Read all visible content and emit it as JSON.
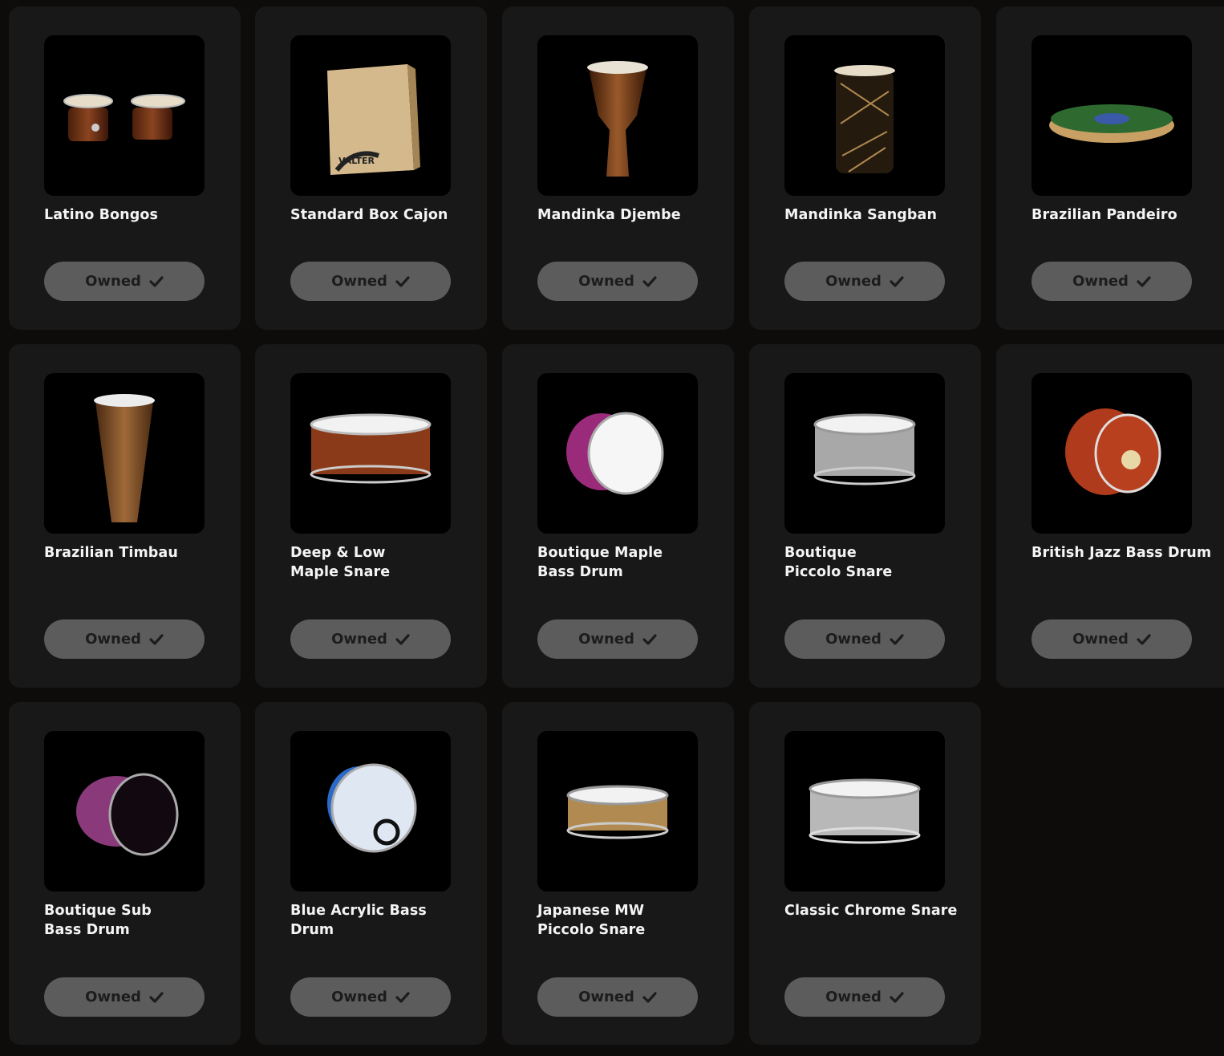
{
  "products": [
    {
      "name": "Latino Bongos",
      "status": "Owned",
      "icon": "bongos-icon"
    },
    {
      "name": "Standard Box Cajon",
      "status": "Owned",
      "icon": "cajon-icon"
    },
    {
      "name": "Mandinka Djembe",
      "status": "Owned",
      "icon": "djembe-icon"
    },
    {
      "name": "Mandinka Sangban",
      "status": "Owned",
      "icon": "sangban-icon"
    },
    {
      "name": "Brazilian Pandeiro",
      "status": "Owned",
      "icon": "pandeiro-icon"
    },
    {
      "name": "Brazilian Timbau",
      "status": "Owned",
      "icon": "timbau-icon"
    },
    {
      "name": "Deep & Low\nMaple Snare",
      "status": "Owned",
      "icon": "snare-icon"
    },
    {
      "name": "Boutique Maple\nBass Drum",
      "status": "Owned",
      "icon": "bass-drum-icon"
    },
    {
      "name": "Boutique\nPiccolo Snare",
      "status": "Owned",
      "icon": "snare-icon"
    },
    {
      "name": "British Jazz Bass Drum",
      "status": "Owned",
      "icon": "bass-drum-icon"
    },
    {
      "name": "Boutique Sub\nBass Drum",
      "status": "Owned",
      "icon": "bass-drum-icon"
    },
    {
      "name": "Blue Acrylic Bass Drum",
      "status": "Owned",
      "icon": "bass-drum-icon"
    },
    {
      "name": "Japanese MW\nPiccolo Snare",
      "status": "Owned",
      "icon": "snare-icon"
    },
    {
      "name": "Classic Chrome Snare",
      "status": "Owned",
      "icon": "snare-icon"
    }
  ],
  "colors": {
    "page_bg": "#0d0c0b",
    "card_bg": "#181818",
    "thumb_bg": "#000000",
    "button_bg": "#5c5c5c",
    "button_text": "#1c1c1c",
    "title_text": "#f4f4f4"
  }
}
